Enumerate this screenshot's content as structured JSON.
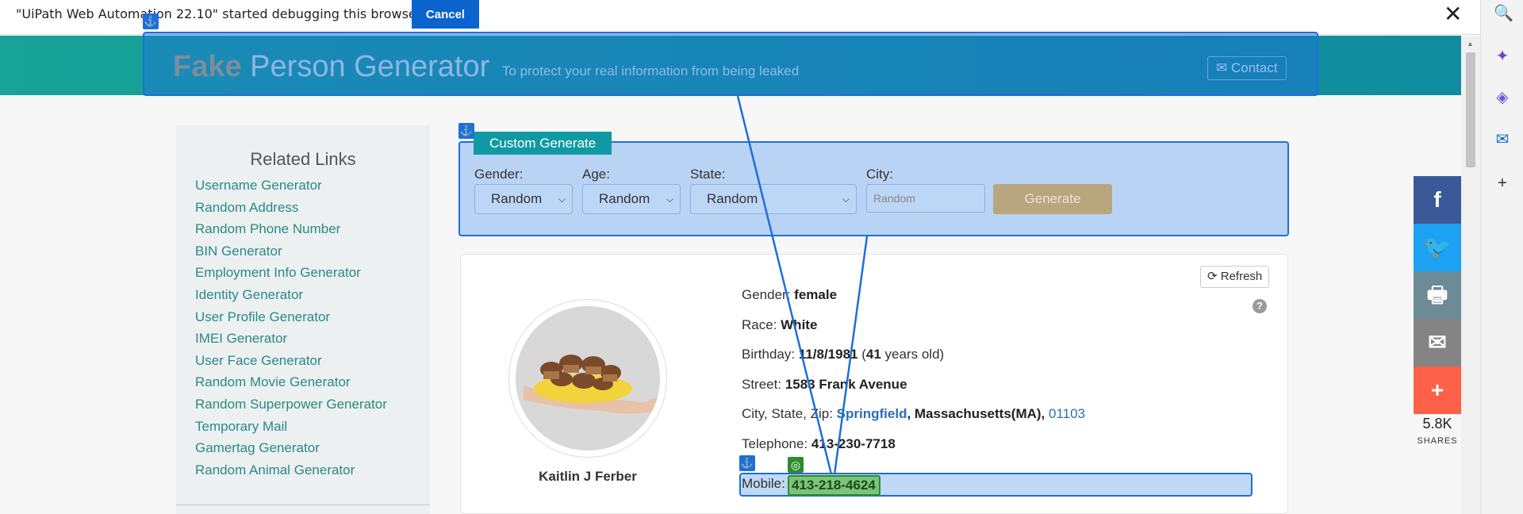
{
  "debug": {
    "message": "\"UiPath Web Automation 22.10\" started debugging this browser",
    "cancel_label": "Cancel",
    "close_icon": "close-icon"
  },
  "header": {
    "brand_fake": "Fake",
    "brand_rest": " Person Generator",
    "tagline": "To protect your real information from being leaked",
    "contact_label": "Contact"
  },
  "sidebar": {
    "title": "Related Links",
    "links": [
      "Username Generator",
      "Random Address",
      "Random Phone Number",
      "BIN Generator",
      "Employment Info Generator",
      "Identity Generator",
      "User Profile Generator",
      "IMEI Generator",
      "User Face Generator",
      "Random Movie Generator",
      "Random Superpower Generator",
      "Temporary Mail",
      "Gamertag Generator",
      "Random Animal Generator"
    ]
  },
  "custom": {
    "tab_label": "Custom Generate",
    "gender_label": "Gender:",
    "gender_value": "Random",
    "age_label": "Age:",
    "age_value": "Random",
    "state_label": "State:",
    "state_value": "Random",
    "city_label": "City:",
    "city_placeholder": "Random",
    "generate_label": "Generate"
  },
  "person": {
    "refresh_label": "Refresh",
    "name": "Kaitlin J Ferber",
    "gender_label": "Gender: ",
    "gender": "female",
    "race_label": "Race: ",
    "race": "White",
    "birthday_label": "Birthday: ",
    "birthday": "11/8/1981",
    "age_open": " (",
    "age": "41",
    "age_suffix": " years old)",
    "street_label": "Street: ",
    "street": "1583 Frank Avenue",
    "csz_label": "City, State, Zip: ",
    "city": "Springfield",
    "state": ", Massachusetts(MA), ",
    "zip": "01103",
    "telephone_label": "Telephone: ",
    "telephone": "413-230-7718",
    "mobile_label": "Mobile: ",
    "mobile": "413-218-4624"
  },
  "share": {
    "count": "5.8K",
    "label": "SHARES"
  },
  "colors": {
    "header_start": "#17a398",
    "header_end": "#0f8c9e",
    "link": "#2a8a80",
    "selection": "#1e6fd9",
    "facebook": "#3b5998",
    "twitter": "#1da1f2",
    "print": "#6d8b97",
    "email": "#848484",
    "more": "#fe6147"
  }
}
